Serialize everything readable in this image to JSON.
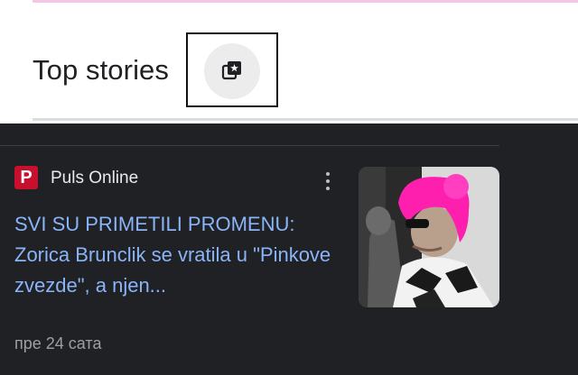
{
  "header": {
    "title": "Top stories",
    "stories_icon": "stories-icon"
  },
  "article": {
    "source": "Puls Online",
    "source_logo_letter": "P",
    "headline": "SVI SU PRIMETILI PROMENU: Zorica Brunclik se vratila u \"Pinkove zvezde\", a njen...",
    "time": "пре 24 сата",
    "more_icon": "more-vert-icon",
    "thumbnail_icon": "article-thumbnail"
  },
  "colors": {
    "headline": "#8ab4f8",
    "panel_bg": "#202124",
    "logo": "#c8102e"
  }
}
